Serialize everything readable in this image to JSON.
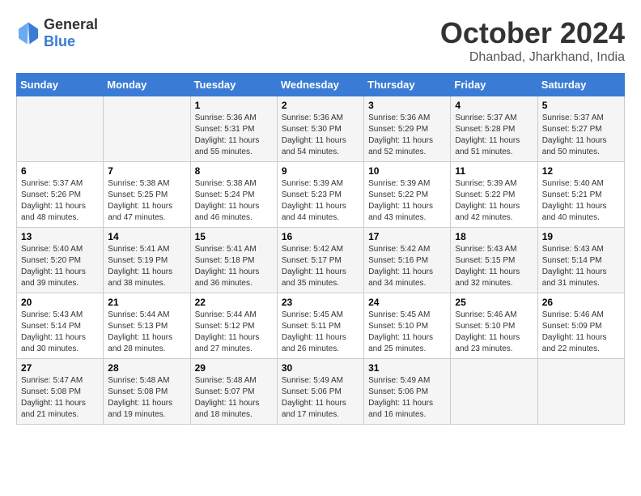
{
  "header": {
    "logo_general": "General",
    "logo_blue": "Blue",
    "month": "October 2024",
    "location": "Dhanbad, Jharkhand, India"
  },
  "days_of_week": [
    "Sunday",
    "Monday",
    "Tuesday",
    "Wednesday",
    "Thursday",
    "Friday",
    "Saturday"
  ],
  "weeks": [
    [
      {
        "day": "",
        "sunrise": "",
        "sunset": "",
        "daylight": ""
      },
      {
        "day": "",
        "sunrise": "",
        "sunset": "",
        "daylight": ""
      },
      {
        "day": "1",
        "sunrise": "Sunrise: 5:36 AM",
        "sunset": "Sunset: 5:31 PM",
        "daylight": "Daylight: 11 hours and 55 minutes."
      },
      {
        "day": "2",
        "sunrise": "Sunrise: 5:36 AM",
        "sunset": "Sunset: 5:30 PM",
        "daylight": "Daylight: 11 hours and 54 minutes."
      },
      {
        "day": "3",
        "sunrise": "Sunrise: 5:36 AM",
        "sunset": "Sunset: 5:29 PM",
        "daylight": "Daylight: 11 hours and 52 minutes."
      },
      {
        "day": "4",
        "sunrise": "Sunrise: 5:37 AM",
        "sunset": "Sunset: 5:28 PM",
        "daylight": "Daylight: 11 hours and 51 minutes."
      },
      {
        "day": "5",
        "sunrise": "Sunrise: 5:37 AM",
        "sunset": "Sunset: 5:27 PM",
        "daylight": "Daylight: 11 hours and 50 minutes."
      }
    ],
    [
      {
        "day": "6",
        "sunrise": "Sunrise: 5:37 AM",
        "sunset": "Sunset: 5:26 PM",
        "daylight": "Daylight: 11 hours and 48 minutes."
      },
      {
        "day": "7",
        "sunrise": "Sunrise: 5:38 AM",
        "sunset": "Sunset: 5:25 PM",
        "daylight": "Daylight: 11 hours and 47 minutes."
      },
      {
        "day": "8",
        "sunrise": "Sunrise: 5:38 AM",
        "sunset": "Sunset: 5:24 PM",
        "daylight": "Daylight: 11 hours and 46 minutes."
      },
      {
        "day": "9",
        "sunrise": "Sunrise: 5:39 AM",
        "sunset": "Sunset: 5:23 PM",
        "daylight": "Daylight: 11 hours and 44 minutes."
      },
      {
        "day": "10",
        "sunrise": "Sunrise: 5:39 AM",
        "sunset": "Sunset: 5:22 PM",
        "daylight": "Daylight: 11 hours and 43 minutes."
      },
      {
        "day": "11",
        "sunrise": "Sunrise: 5:39 AM",
        "sunset": "Sunset: 5:22 PM",
        "daylight": "Daylight: 11 hours and 42 minutes."
      },
      {
        "day": "12",
        "sunrise": "Sunrise: 5:40 AM",
        "sunset": "Sunset: 5:21 PM",
        "daylight": "Daylight: 11 hours and 40 minutes."
      }
    ],
    [
      {
        "day": "13",
        "sunrise": "Sunrise: 5:40 AM",
        "sunset": "Sunset: 5:20 PM",
        "daylight": "Daylight: 11 hours and 39 minutes."
      },
      {
        "day": "14",
        "sunrise": "Sunrise: 5:41 AM",
        "sunset": "Sunset: 5:19 PM",
        "daylight": "Daylight: 11 hours and 38 minutes."
      },
      {
        "day": "15",
        "sunrise": "Sunrise: 5:41 AM",
        "sunset": "Sunset: 5:18 PM",
        "daylight": "Daylight: 11 hours and 36 minutes."
      },
      {
        "day": "16",
        "sunrise": "Sunrise: 5:42 AM",
        "sunset": "Sunset: 5:17 PM",
        "daylight": "Daylight: 11 hours and 35 minutes."
      },
      {
        "day": "17",
        "sunrise": "Sunrise: 5:42 AM",
        "sunset": "Sunset: 5:16 PM",
        "daylight": "Daylight: 11 hours and 34 minutes."
      },
      {
        "day": "18",
        "sunrise": "Sunrise: 5:43 AM",
        "sunset": "Sunset: 5:15 PM",
        "daylight": "Daylight: 11 hours and 32 minutes."
      },
      {
        "day": "19",
        "sunrise": "Sunrise: 5:43 AM",
        "sunset": "Sunset: 5:14 PM",
        "daylight": "Daylight: 11 hours and 31 minutes."
      }
    ],
    [
      {
        "day": "20",
        "sunrise": "Sunrise: 5:43 AM",
        "sunset": "Sunset: 5:14 PM",
        "daylight": "Daylight: 11 hours and 30 minutes."
      },
      {
        "day": "21",
        "sunrise": "Sunrise: 5:44 AM",
        "sunset": "Sunset: 5:13 PM",
        "daylight": "Daylight: 11 hours and 28 minutes."
      },
      {
        "day": "22",
        "sunrise": "Sunrise: 5:44 AM",
        "sunset": "Sunset: 5:12 PM",
        "daylight": "Daylight: 11 hours and 27 minutes."
      },
      {
        "day": "23",
        "sunrise": "Sunrise: 5:45 AM",
        "sunset": "Sunset: 5:11 PM",
        "daylight": "Daylight: 11 hours and 26 minutes."
      },
      {
        "day": "24",
        "sunrise": "Sunrise: 5:45 AM",
        "sunset": "Sunset: 5:10 PM",
        "daylight": "Daylight: 11 hours and 25 minutes."
      },
      {
        "day": "25",
        "sunrise": "Sunrise: 5:46 AM",
        "sunset": "Sunset: 5:10 PM",
        "daylight": "Daylight: 11 hours and 23 minutes."
      },
      {
        "day": "26",
        "sunrise": "Sunrise: 5:46 AM",
        "sunset": "Sunset: 5:09 PM",
        "daylight": "Daylight: 11 hours and 22 minutes."
      }
    ],
    [
      {
        "day": "27",
        "sunrise": "Sunrise: 5:47 AM",
        "sunset": "Sunset: 5:08 PM",
        "daylight": "Daylight: 11 hours and 21 minutes."
      },
      {
        "day": "28",
        "sunrise": "Sunrise: 5:48 AM",
        "sunset": "Sunset: 5:08 PM",
        "daylight": "Daylight: 11 hours and 19 minutes."
      },
      {
        "day": "29",
        "sunrise": "Sunrise: 5:48 AM",
        "sunset": "Sunset: 5:07 PM",
        "daylight": "Daylight: 11 hours and 18 minutes."
      },
      {
        "day": "30",
        "sunrise": "Sunrise: 5:49 AM",
        "sunset": "Sunset: 5:06 PM",
        "daylight": "Daylight: 11 hours and 17 minutes."
      },
      {
        "day": "31",
        "sunrise": "Sunrise: 5:49 AM",
        "sunset": "Sunset: 5:06 PM",
        "daylight": "Daylight: 11 hours and 16 minutes."
      },
      {
        "day": "",
        "sunrise": "",
        "sunset": "",
        "daylight": ""
      },
      {
        "day": "",
        "sunrise": "",
        "sunset": "",
        "daylight": ""
      }
    ]
  ]
}
